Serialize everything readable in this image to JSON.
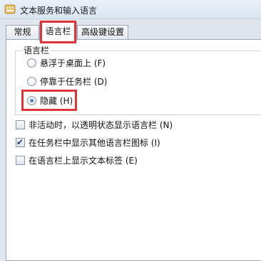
{
  "window": {
    "title": "文本服务和输入语言"
  },
  "tabs": [
    {
      "label": "常规",
      "selected": false
    },
    {
      "label": "语言栏",
      "selected": true
    },
    {
      "label": "高级键设置",
      "selected": false
    }
  ],
  "language_bar_group": {
    "legend": "语言栏",
    "options": [
      {
        "label": "悬浮于桌面上 (F)",
        "checked": false
      },
      {
        "label": "停靠于任务栏 (D)",
        "checked": false
      },
      {
        "label": "隐藏 (H)",
        "checked": true
      }
    ]
  },
  "checkboxes": [
    {
      "label": "非活动时，以透明状态显示语言栏 (N)",
      "checked": false
    },
    {
      "label": "在任务栏中显示其他语言栏图标 (I)",
      "checked": true
    },
    {
      "label": "在语言栏上显示文本标签 (E)",
      "checked": false
    }
  ],
  "colors": {
    "highlight": "#e0343a",
    "window_background": "#dfe6ee",
    "panel_background": "#ffffff"
  }
}
